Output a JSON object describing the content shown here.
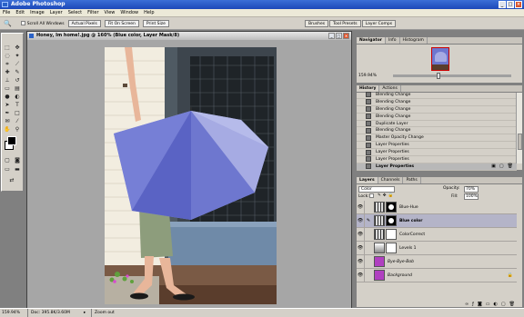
{
  "app": {
    "title": "Adobe Photoshop",
    "menu": [
      "File",
      "Edit",
      "Image",
      "Layer",
      "Select",
      "Filter",
      "View",
      "Window",
      "Help"
    ]
  },
  "options": {
    "scroll_all_windows": "Scroll All Windows",
    "actual_pixels": "Actual Pixels",
    "fit_on_screen": "Fit On Screen",
    "print_size": "Print Size"
  },
  "panel_well": [
    "Brushes",
    "Tool Presets",
    "Layer Comps"
  ],
  "document": {
    "title": "Honey, Im home!.jpg @ 160% (Blue color, Layer Mask/8)"
  },
  "navigator": {
    "tabs": [
      "Navigator",
      "Info",
      "Histogram"
    ],
    "zoom": "159.94%"
  },
  "history": {
    "tabs": [
      "History",
      "Actions"
    ],
    "items": [
      "Blending Change",
      "Blending Change",
      "Blending Change",
      "Blending Change",
      "Duplicate Layer",
      "Blending Change",
      "Master Opacity Change",
      "Layer Properties",
      "Layer Properties",
      "Layer Properties",
      "Layer Properties"
    ],
    "selected_index": 10
  },
  "layers": {
    "tabs": [
      "Layers",
      "Channels",
      "Paths"
    ],
    "blend_mode": "Color",
    "opacity_label": "Opacity:",
    "opacity": "70%",
    "lock_label": "Lock:",
    "fill_label": "Fill:",
    "fill": "100%",
    "items": [
      {
        "name": "Blue-Hue",
        "selected": false
      },
      {
        "name": "Blue color",
        "selected": true
      },
      {
        "name": "ColorCorrect",
        "selected": false
      },
      {
        "name": "Levels 1",
        "selected": false
      },
      {
        "name": "Bye-Bye-Bob",
        "selected": false
      },
      {
        "name": "Background",
        "selected": false
      }
    ]
  },
  "status": {
    "zoom": "159.94%",
    "doc": "Doc: 395.8K/3.60M",
    "message": "Zoom out"
  }
}
